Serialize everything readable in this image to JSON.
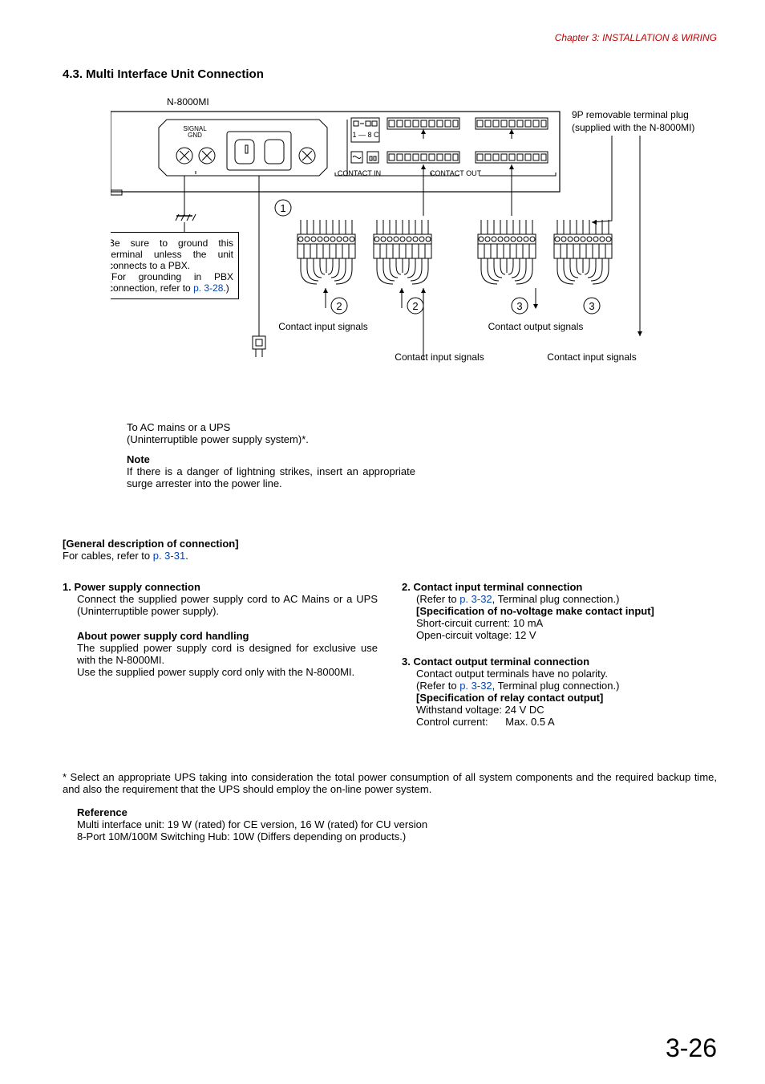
{
  "chapter": "Chapter 3:  INSTALLATION & WIRING",
  "section_title": "4.3. Multi Interface Unit Connection",
  "diagram": {
    "device_label": "N-8000MI",
    "signal_gnd1": "SIGNAL",
    "signal_gnd2": "GND",
    "one_eight_c": "1 — 8 C",
    "contact_in": "CONTACT IN",
    "contact_out": "CONTACT OUT",
    "plug_line1": "9P removable terminal plug",
    "plug_line2": "(supplied with the N-8000MI)",
    "ground_note_l1": "Be sure to ground this terminal unless the unit connects to a PBX.",
    "ground_note_l2_pre": "(For grounding in PBX connection, refer to ",
    "ground_note_link": "p. 3-28",
    "ground_note_l2_post": ".)",
    "contact_input_signals": "Contact input signals",
    "contact_output_signals": "Contact output signals",
    "contact_input_signals2": "Contact input signals",
    "contact_input_signals3": "Contact input signals"
  },
  "ac_mains_l1": "To AC mains or a UPS",
  "ac_mains_l2": "(Uninterruptible power supply system)*.",
  "note_head": "Note",
  "note_body": "If there is a danger of lightning strikes, insert an appropriate surge arrester into the power line.",
  "general_head": "[General description of connection]",
  "general_pre": "For cables, refer to ",
  "general_link": "p. 3-31",
  "general_post": ".",
  "item1_head": "1. Power supply connection",
  "item1_body": "Connect the supplied power supply cord to AC Mains or a UPS (Uninterruptible power supply).",
  "item1_sub_head": "About power supply cord handling",
  "item1_sub_body1": "The supplied power supply cord is designed for exclusive use with the N-8000MI.",
  "item1_sub_body2": "Use the supplied power supply cord only with the N-8000MI.",
  "item2_head": "2. Contact input terminal connection",
  "item2_refer_pre": "(Refer to ",
  "item2_refer_link": "p. 3-32",
  "item2_refer_post": ", Terminal plug connection.)",
  "item2_spec_head": "[Specification of no-voltage make contact input]",
  "item2_spec1": "Short-circuit current:  10 mA",
  "item2_spec2": "Open-circuit voltage:  12 V",
  "item3_head": "3. Contact output terminal connection",
  "item3_body1": "Contact output terminals have no polarity.",
  "item3_refer_pre": "(Refer to ",
  "item3_refer_link": "p. 3-32",
  "item3_refer_post": ", Terminal plug connection.)",
  "item3_spec_head": "[Specification of relay contact output]",
  "item3_spec1": "Withstand voltage:  24 V DC",
  "item3_spec2": "Control current:      Max. 0.5 A",
  "footnote": "* Select an appropriate UPS taking into consideration the total power consumption of all system components and the required backup time, and also the requirement that the UPS should employ the on-line power system.",
  "reference_head": "Reference",
  "reference_l1": "Multi interface unit: 19 W (rated) for CE version, 16 W (rated) for CU version",
  "reference_l2": "8-Port 10M/100M Switching Hub: 10W (Differs depending on products.)",
  "page_num": "3-26"
}
